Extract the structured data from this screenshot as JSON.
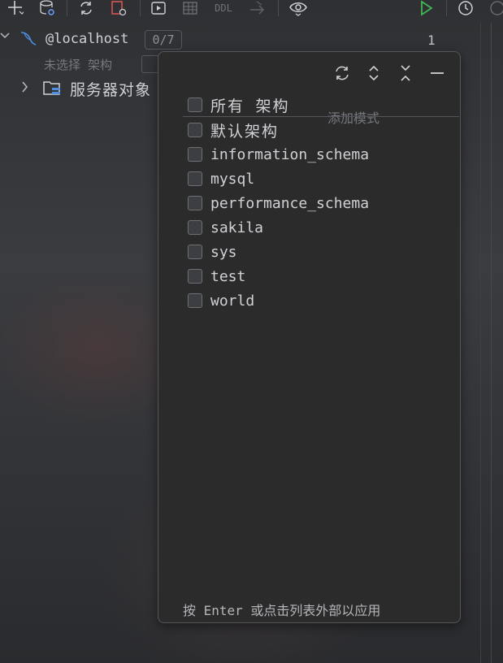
{
  "toolbar": {
    "items": [
      {
        "name": "add-icon",
        "glyph": "+"
      },
      {
        "name": "database-settings-icon",
        "glyph": "⛁"
      },
      {
        "name": "refresh-icon",
        "glyph": "⟳"
      },
      {
        "name": "disconnect-icon",
        "glyph": "⊡"
      },
      {
        "name": "run-console-icon",
        "glyph": "▶"
      },
      {
        "name": "table-icon",
        "glyph": "▦"
      },
      {
        "name": "jump-icon",
        "glyph": "→"
      },
      {
        "name": "view-icon",
        "glyph": "👁"
      },
      {
        "name": "run-icon",
        "glyph": "▷"
      },
      {
        "name": "history-icon",
        "glyph": "◷"
      }
    ],
    "ddl_label": "DDL",
    "run_color": "#3fb950"
  },
  "tree": {
    "host": "@localhost",
    "host_badge": "0/7",
    "schema_selector": "未选择 架构",
    "folder_label": "服务器对象"
  },
  "editor": {
    "line_number": "1"
  },
  "popup": {
    "icons": [
      "refresh-icon",
      "expand-icon",
      "collapse-icon",
      "minimize-icon"
    ],
    "all_label": "所有 架构",
    "add_mode_placeholder": "添加模式",
    "schemas": [
      "默认架构",
      "information_schema",
      "mysql",
      "performance_schema",
      "sakila",
      "sys",
      "test",
      "world"
    ],
    "footer": "按 Enter 或点击列表外部以应用"
  }
}
